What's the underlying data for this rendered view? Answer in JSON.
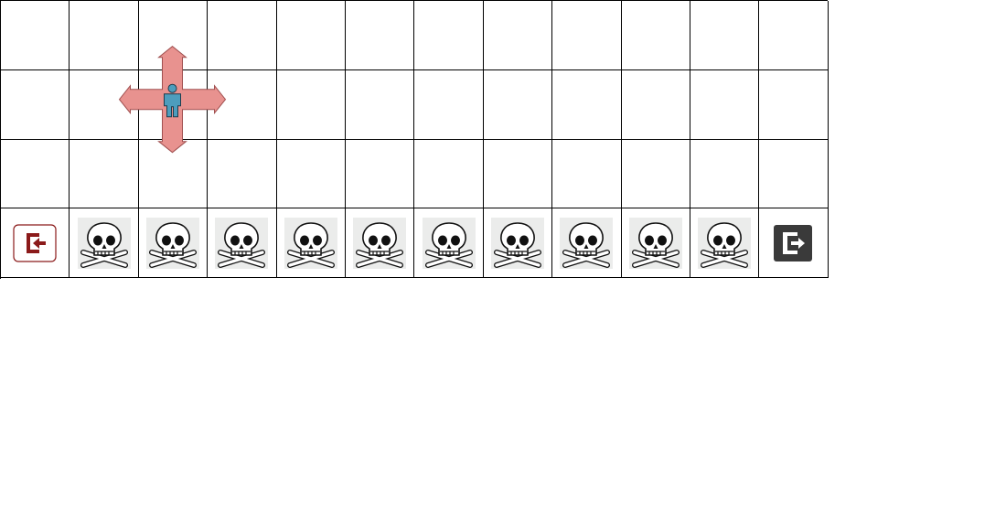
{
  "grid": {
    "rows": 4,
    "cols": 12
  },
  "colors": {
    "cell_border": "#000000",
    "arrow_fill": "#e8928f",
    "arrow_stroke": "#a05050",
    "agent_fill": "#4d9dbd",
    "agent_stroke": "#1e3d4d",
    "start_color": "#8b1a1a",
    "goal_color": "#3a3a3a",
    "skull_bg": "#ebeceb"
  },
  "agent": {
    "row": 1,
    "col": 2,
    "icon": "person-icon",
    "moves": [
      "up",
      "down",
      "left",
      "right"
    ]
  },
  "start": {
    "row": 3,
    "col": 0,
    "icon": "enter-door-icon"
  },
  "goal": {
    "row": 3,
    "col": 11,
    "icon": "exit-door-icon"
  },
  "cliff": {
    "row": 3,
    "cols": [
      1,
      2,
      3,
      4,
      5,
      6,
      7,
      8,
      9,
      10
    ],
    "icon": "skull-crossbones-icon"
  }
}
